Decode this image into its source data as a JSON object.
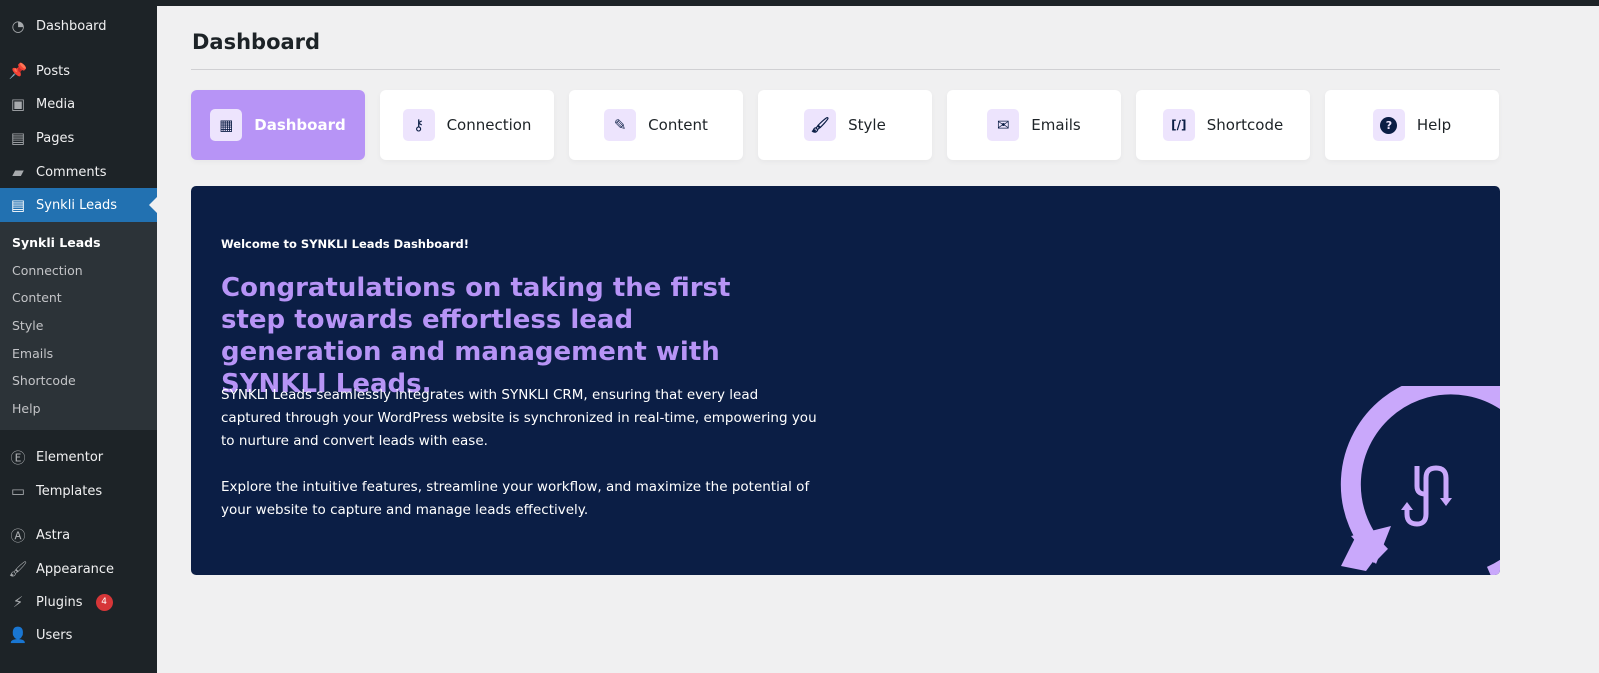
{
  "sidebar": {
    "items": [
      {
        "label": "Dashboard",
        "icon": "dashboard-icon"
      },
      {
        "label": "Posts",
        "icon": "pin-icon"
      },
      {
        "label": "Media",
        "icon": "media-icon"
      },
      {
        "label": "Pages",
        "icon": "pages-icon"
      },
      {
        "label": "Comments",
        "icon": "comment-icon"
      },
      {
        "label": "Synkli Leads",
        "icon": "synkli-icon"
      },
      {
        "label": "Elementor",
        "icon": "elementor-icon"
      },
      {
        "label": "Templates",
        "icon": "folder-icon"
      },
      {
        "label": "Astra",
        "icon": "astra-icon"
      },
      {
        "label": "Appearance",
        "icon": "brush-icon"
      },
      {
        "label": "Plugins",
        "icon": "plugin-icon",
        "badge": "4"
      },
      {
        "label": "Users",
        "icon": "user-icon"
      }
    ],
    "submenu": [
      "Synkli Leads",
      "Connection",
      "Content",
      "Style",
      "Emails",
      "Shortcode",
      "Help"
    ]
  },
  "page_title": "Dashboard",
  "tabs": [
    {
      "label": "Dashboard",
      "glyph": "▦"
    },
    {
      "label": "Connection",
      "glyph": "⚷"
    },
    {
      "label": "Content",
      "glyph": "✎"
    },
    {
      "label": "Style",
      "glyph": "🖌"
    },
    {
      "label": "Emails",
      "glyph": "✉"
    },
    {
      "label": "Shortcode",
      "glyph": "[/]"
    },
    {
      "label": "Help",
      "glyph": "?"
    }
  ],
  "banner": {
    "welcome": "Welcome to SYNKLI Leads Dashboard!",
    "headline": "Congratulations on taking the first step towards effortless lead generation and management with SYNKLI Leads.",
    "p1": "SYNKLI Leads seamlessly integrates with SYNKLI CRM, ensuring that every lead captured through your WordPress website is synchronized in real-time, empowering you to nurture and convert leads with ease.",
    "p2": "Explore the intuitive features, streamline your workflow, and maximize the potential of your website to capture and manage leads effectively."
  },
  "colors": {
    "accent": "#b794f6",
    "banner": "#0b1e45",
    "wp_active": "#2271b1"
  }
}
